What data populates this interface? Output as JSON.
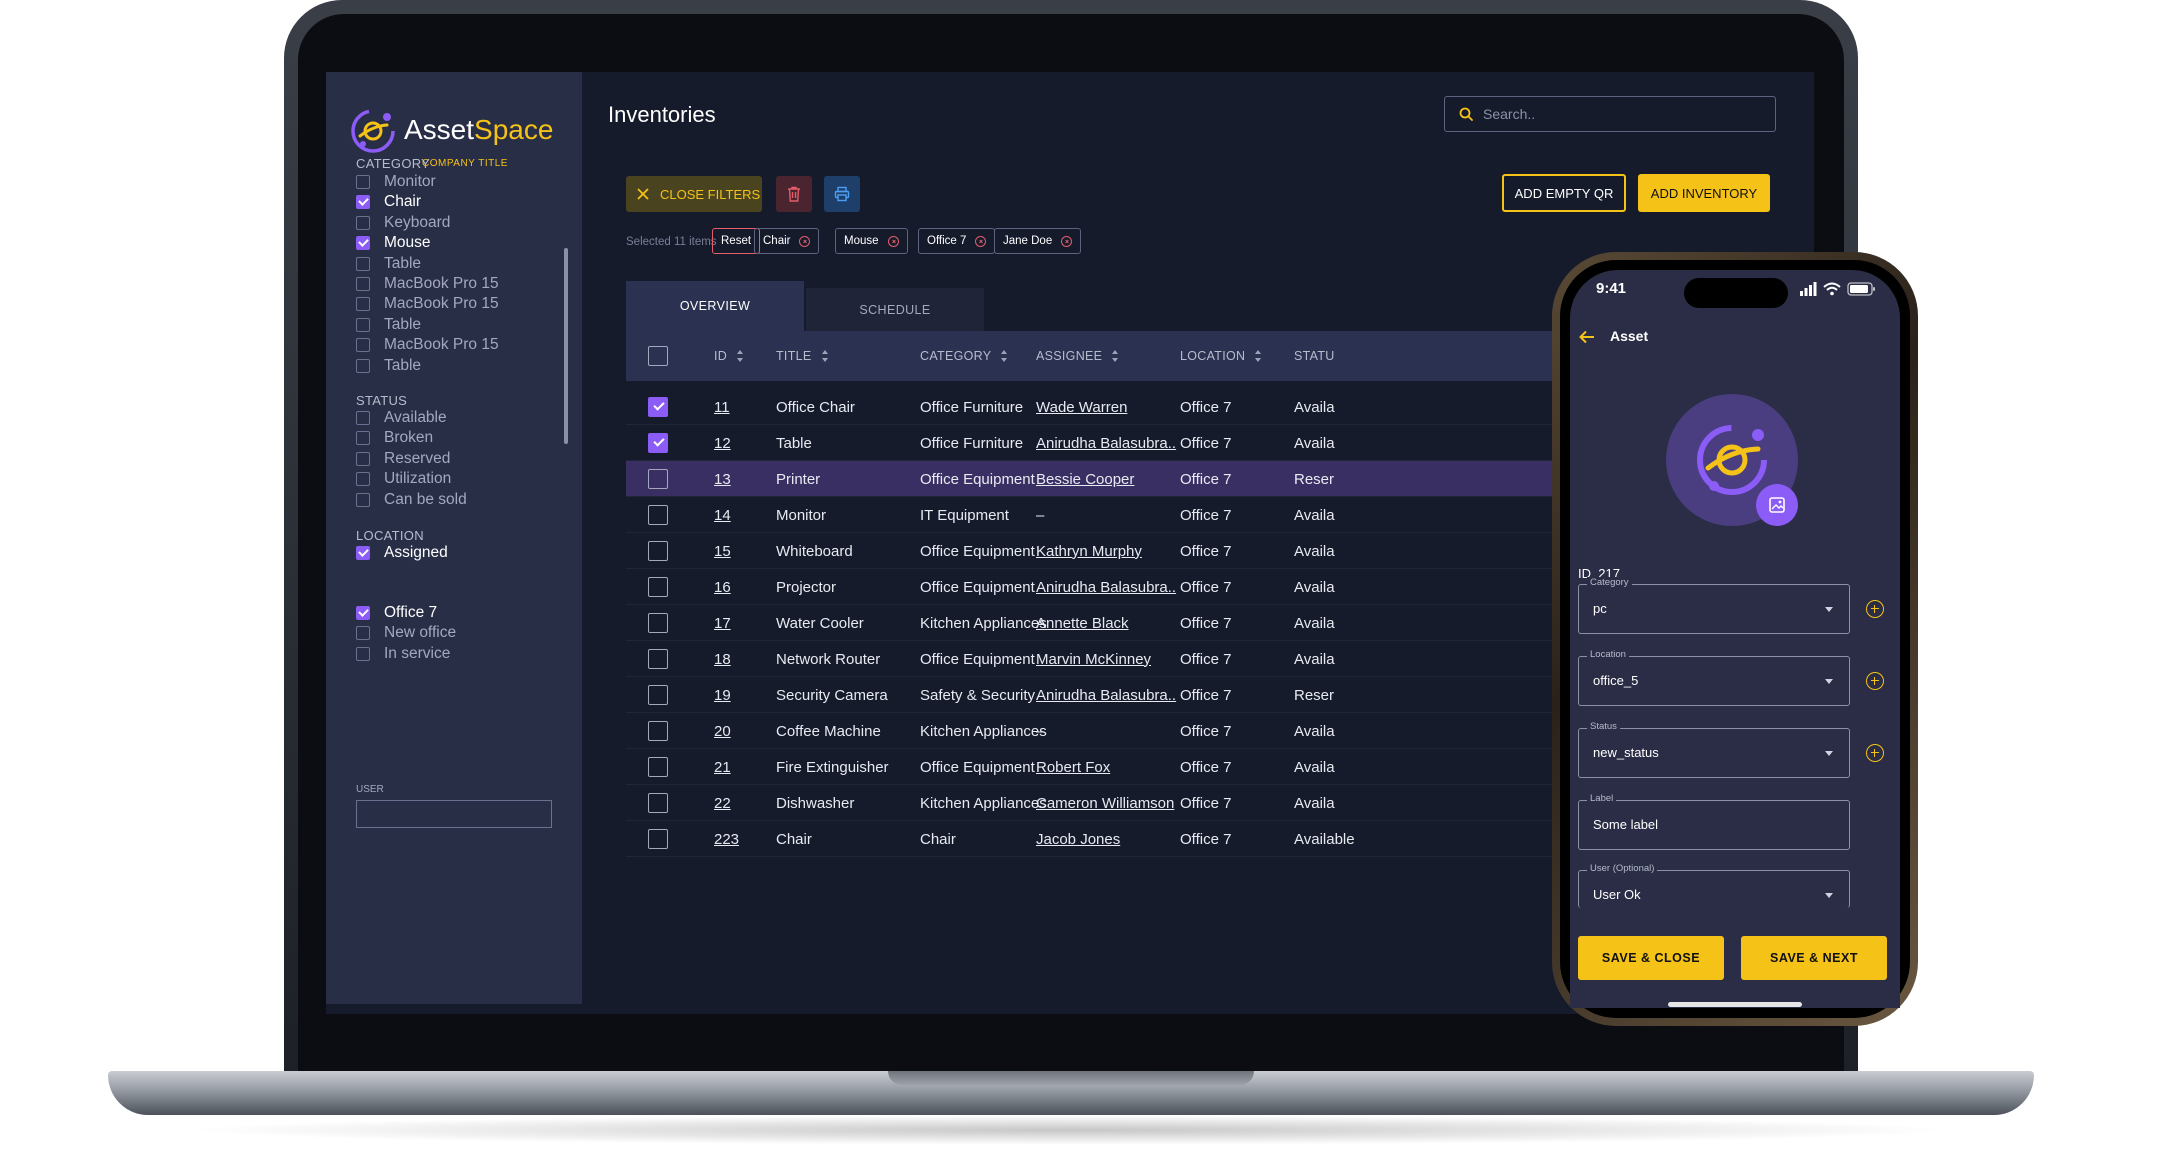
{
  "app": {
    "name_part1": "Asset",
    "name_part2": "Space",
    "company_title": "COMPANY TITLE"
  },
  "colors": {
    "accent": "#f5c218",
    "purple": "#8b5cf6",
    "sidebar": "#292e47",
    "bg": "#161b2c"
  },
  "sidebar": {
    "category": {
      "title": "CATEGORY",
      "items": [
        {
          "label": "Monitor",
          "checked": false
        },
        {
          "label": "Chair",
          "checked": true
        },
        {
          "label": "Keyboard",
          "checked": false
        },
        {
          "label": "Mouse",
          "checked": true
        },
        {
          "label": "Table",
          "checked": false
        },
        {
          "label": "MacBook Pro 15",
          "checked": false
        },
        {
          "label": "MacBook Pro 15",
          "checked": false
        },
        {
          "label": "Table",
          "checked": false
        },
        {
          "label": "MacBook Pro 15",
          "checked": false
        },
        {
          "label": "Table",
          "checked": false
        }
      ]
    },
    "status": {
      "title": "STATUS",
      "items": [
        {
          "label": "Available",
          "checked": false
        },
        {
          "label": "Broken",
          "checked": false
        },
        {
          "label": "Reserved",
          "checked": false
        },
        {
          "label": "Utilization",
          "checked": false
        },
        {
          "label": "Can be sold",
          "checked": false
        }
      ]
    },
    "location": {
      "title": "LOCATION",
      "assigned": {
        "label": "Assigned",
        "checked": true
      },
      "user_label": "USER",
      "items": [
        {
          "label": "Office 7",
          "checked": true
        },
        {
          "label": "New office",
          "checked": false
        },
        {
          "label": "In service",
          "checked": false
        }
      ]
    }
  },
  "header": {
    "title": "Inventories",
    "search_placeholder": "Search.."
  },
  "toolbar": {
    "close_filters": "CLOSE FILTERS",
    "add_empty_qr": "ADD EMPTY QR",
    "add_inventory": "ADD INVENTORY"
  },
  "filters": {
    "selected_text": "Selected 11 items",
    "reset": "Reset",
    "chips": [
      "Chair",
      "Mouse",
      "Office 7",
      "Jane Doe"
    ]
  },
  "tabs": {
    "overview": "OVERVIEW",
    "schedule": "SCHEDULE"
  },
  "table": {
    "headers": {
      "id": "ID",
      "title": "TITLE",
      "category": "CATEGORY",
      "assignee": "ASSIGNEE",
      "location": "LOCATION",
      "status": "STATU"
    },
    "rows": [
      {
        "id": "11",
        "title": "Office Chair",
        "category": "Office Furniture",
        "assignee": "Wade Warren",
        "location": "Office 7",
        "status": "Availa",
        "checked": true
      },
      {
        "id": "12",
        "title": "Table",
        "category": "Office Furniture",
        "assignee": "Anirudha Balasubra..",
        "location": "Office 7",
        "status": "Availa",
        "checked": true
      },
      {
        "id": "13",
        "title": "Printer",
        "category": "Office Equipment",
        "assignee": "Bessie Cooper",
        "location": "Office 7",
        "status": "Reser",
        "checked": false,
        "highlight": true
      },
      {
        "id": "14",
        "title": "Monitor",
        "category": "IT Equipment",
        "assignee": "–",
        "location": "Office 7",
        "status": "Availa",
        "checked": false
      },
      {
        "id": "15",
        "title": "Whiteboard",
        "category": "Office Equipment",
        "assignee": "Kathryn Murphy",
        "location": "Office 7",
        "status": "Availa",
        "checked": false
      },
      {
        "id": "16",
        "title": "Projector",
        "category": "Office Equipment",
        "assignee": "Anirudha Balasubra..",
        "location": "Office 7",
        "status": "Availa",
        "checked": false
      },
      {
        "id": "17",
        "title": "Water Cooler",
        "category": "Kitchen Appliances",
        "assignee": "Annette Black",
        "location": "Office 7",
        "status": "Availa",
        "checked": false
      },
      {
        "id": "18",
        "title": "Network Router",
        "category": "Office Equipment",
        "assignee": "Marvin McKinney",
        "location": "Office 7",
        "status": "Availa",
        "checked": false
      },
      {
        "id": "19",
        "title": "Security Camera",
        "category": "Safety & Security",
        "assignee": "Anirudha Balasubra..",
        "location": "Office 7",
        "status": "Reser",
        "checked": false
      },
      {
        "id": "20",
        "title": "Coffee Machine",
        "category": "Kitchen Appliances",
        "assignee": "–",
        "location": "Office 7",
        "status": "Availa",
        "checked": false
      },
      {
        "id": "21",
        "title": "Fire Extinguisher",
        "category": "Office Equipment",
        "assignee": "Robert Fox",
        "location": "Office 7",
        "status": "Availa",
        "checked": false
      },
      {
        "id": "22",
        "title": "Dishwasher",
        "category": "Kitchen Appliances",
        "assignee": "Cameron Williamson",
        "location": "Office 7",
        "status": "Availa",
        "checked": false
      },
      {
        "id": "223",
        "title": "Chair",
        "category": "Chair",
        "assignee": "Jacob Jones",
        "location": "Office 7",
        "status": "Available",
        "checked": false
      }
    ]
  },
  "phone": {
    "time": "9:41",
    "title": "Asset",
    "id_label": "ID",
    "id_value": "217",
    "fields": [
      {
        "label": "Category",
        "value": "pc",
        "dropdown": true,
        "add": true
      },
      {
        "label": "Location",
        "value": "office_5",
        "dropdown": true,
        "add": true
      },
      {
        "label": "Status",
        "value": "new_status",
        "dropdown": true,
        "add": true
      },
      {
        "label": "Label",
        "value": "Some label",
        "dropdown": false,
        "add": false
      },
      {
        "label": "User (Optional)",
        "value": "User Ok",
        "dropdown": true,
        "add": false
      }
    ],
    "save_close": "SAVE & CLOSE",
    "save_next": "SAVE & NEXT"
  }
}
